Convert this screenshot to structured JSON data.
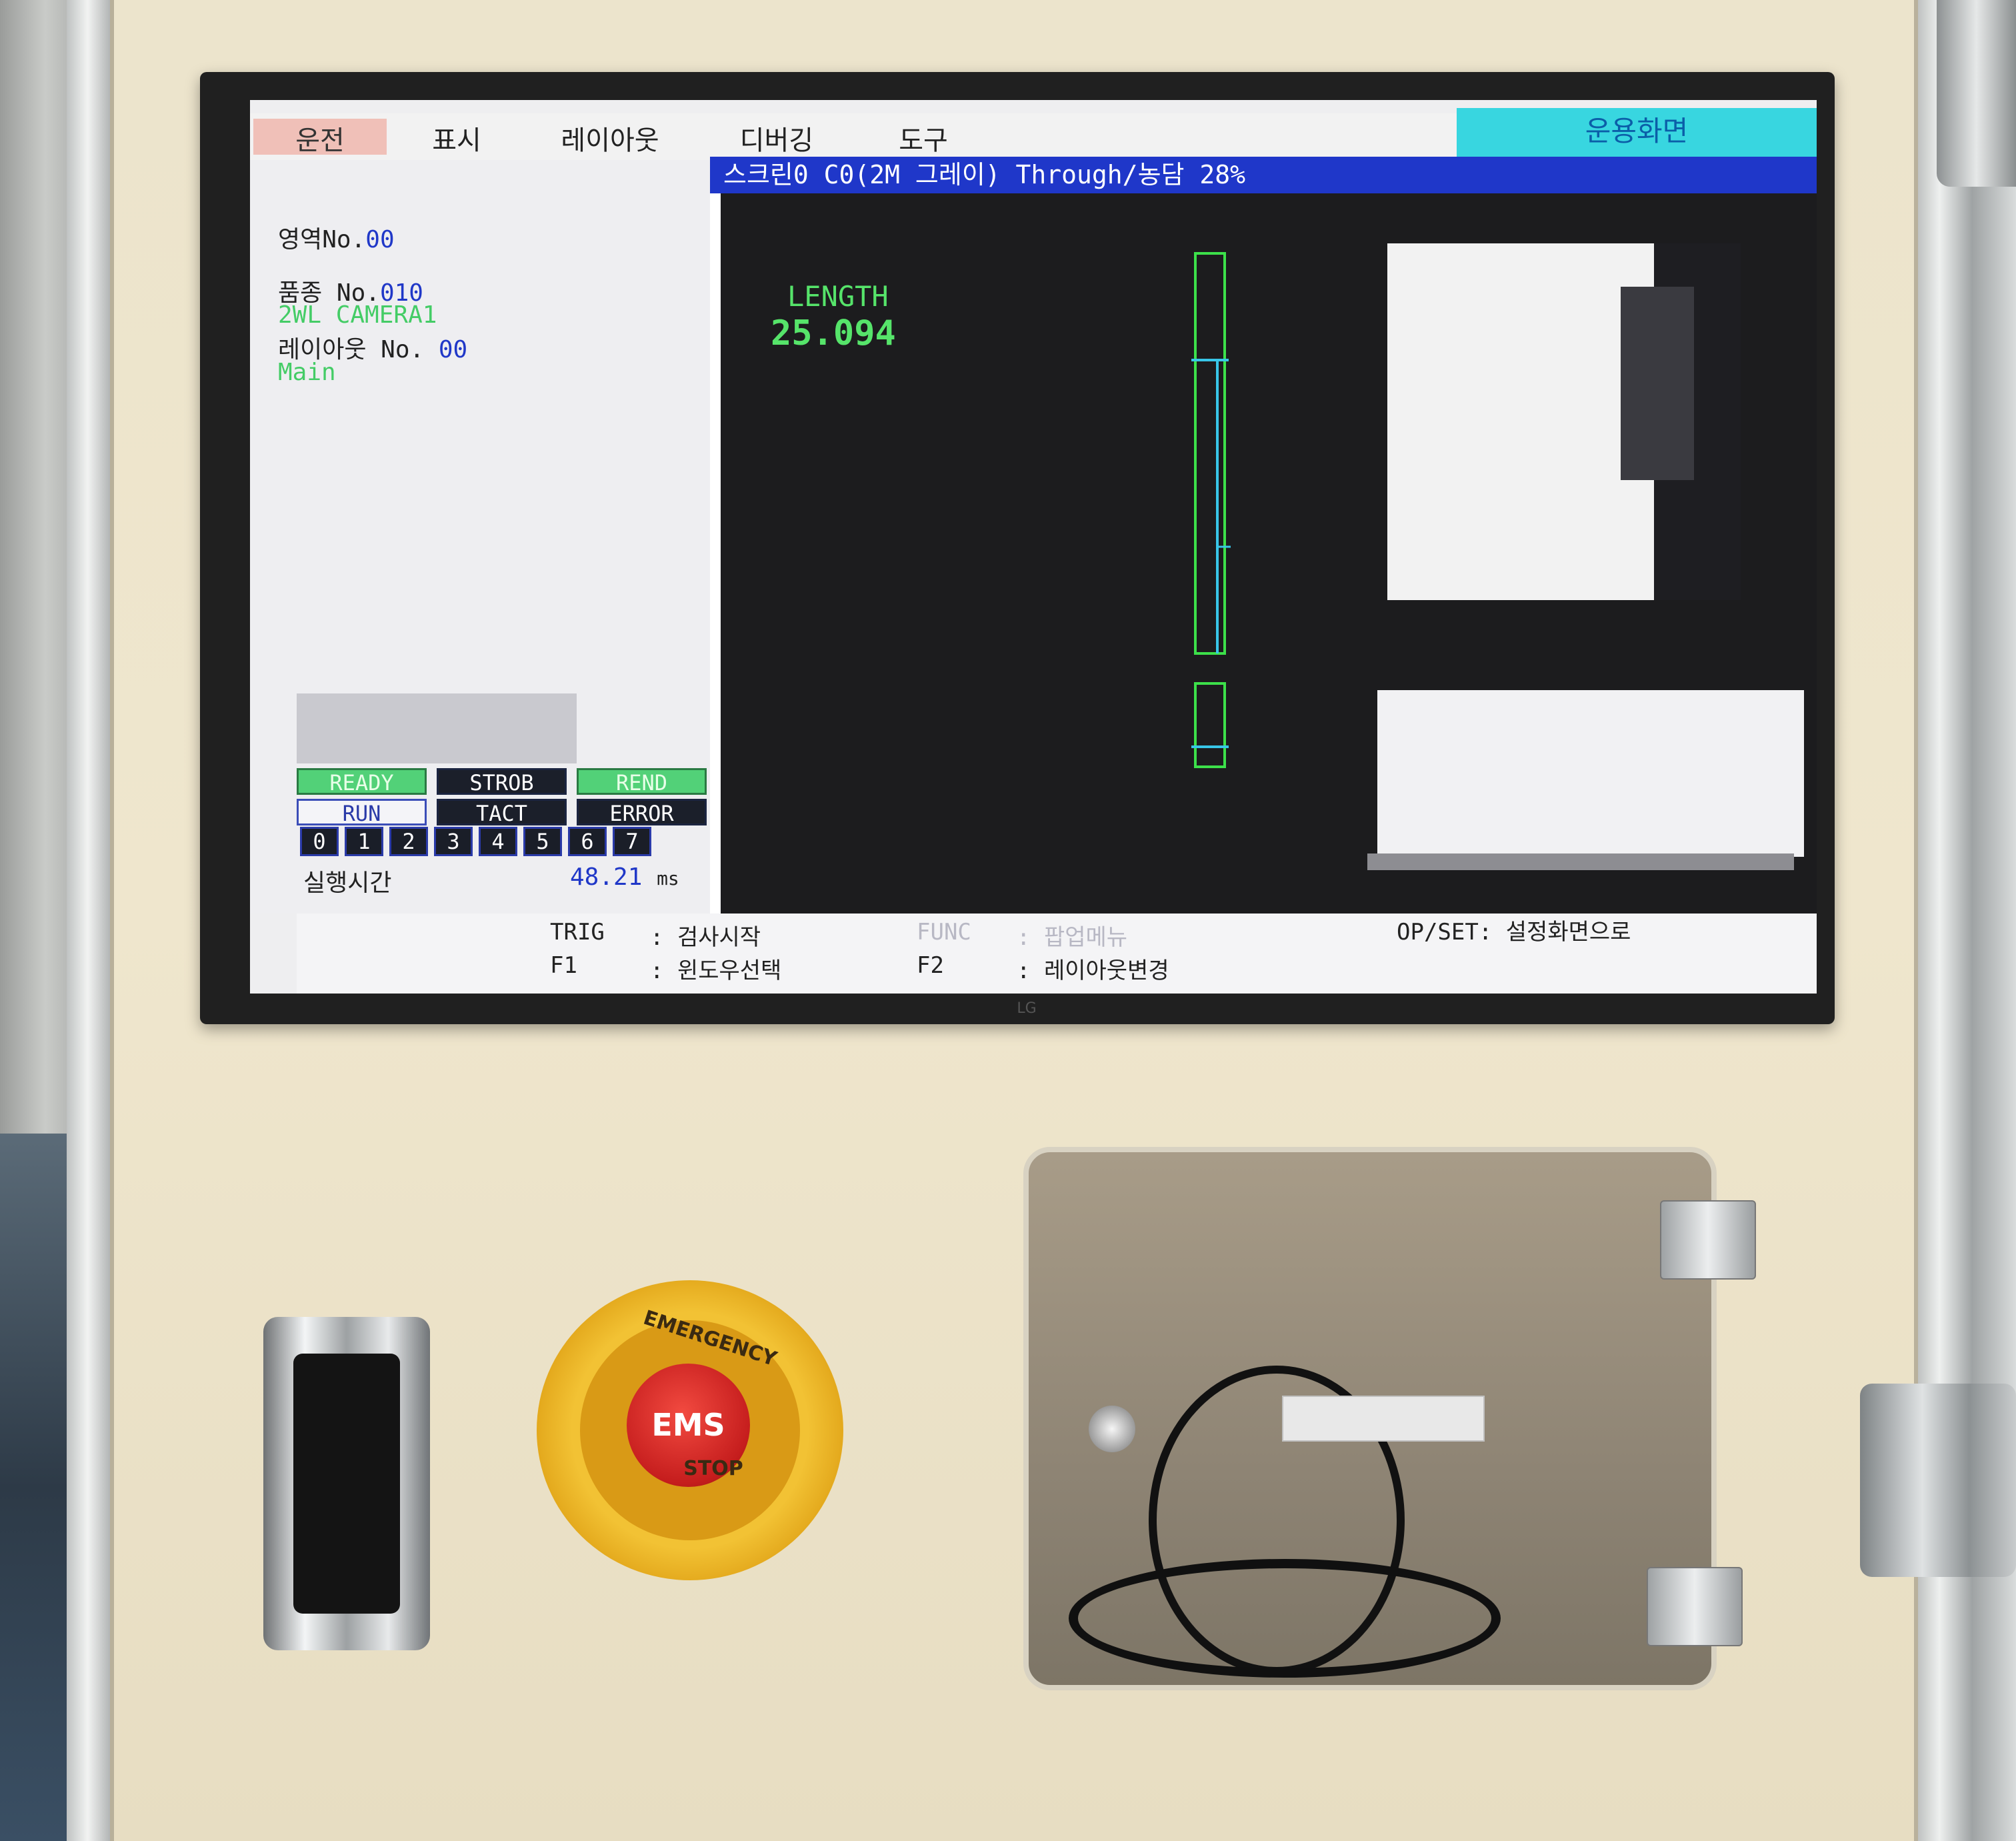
{
  "menu": {
    "items": [
      "운전",
      "표시",
      "레이아웃",
      "디버깅",
      "도구"
    ],
    "mode_label": "운용화면"
  },
  "info": {
    "area_label": "영역No.",
    "area_value": "00",
    "product_label": "품종 No.",
    "product_value": "010",
    "camera_name": "2WL CAMERA1",
    "layout_label": "레이아웃 No.",
    "layout_value": "00",
    "layout_name": "Main",
    "exec_time_label": "실행시간",
    "exec_time_value": "48.21",
    "exec_time_unit": "ms"
  },
  "status": {
    "ready": "READY",
    "strob": "STROB",
    "rend": "REND",
    "run": "RUN",
    "tact": "TACT",
    "error": "ERROR",
    "numbers": [
      "0",
      "1",
      "2",
      "3",
      "4",
      "5",
      "6",
      "7"
    ]
  },
  "view": {
    "title": "스크린0 C0(2M 그레이) Through/농담 28%",
    "measure_label": "LENGTH",
    "measure_value": "25.094"
  },
  "footer": {
    "trig_key": "TRIG",
    "trig_action": ": 검사시작",
    "func_key": "FUNC",
    "func_action": ": 팝업메뉴",
    "opset": "OP/SET: 설정화면으로",
    "f1_key": "F1",
    "f1_action": ": 윈도우선택",
    "f2_key": "F2",
    "f2_action": ": 레이아웃변경"
  },
  "hardware": {
    "monitor_brand": "LG",
    "ems_label": "EMS",
    "ems_top_text": "EMERGENCY",
    "ems_bottom_text": "STOP"
  },
  "colors": {
    "accent_cyan": "#38d6e0",
    "title_blue": "#1f37c9",
    "measure_green": "#56e46a"
  }
}
